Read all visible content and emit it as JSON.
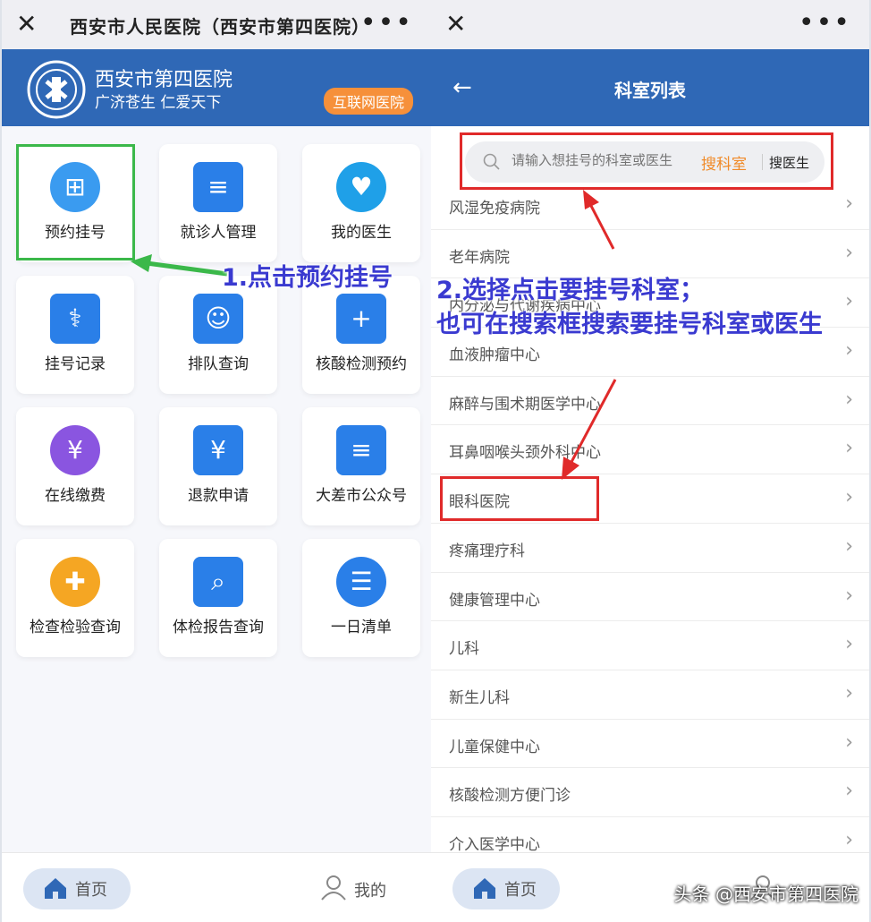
{
  "left_screen": {
    "window_title": "西安市人民医院（西安市第四医院）",
    "header": {
      "hospital_name": "西安市第四医院",
      "slogan": "广济苍生 仁爱天下",
      "badge": "互联网医院"
    },
    "services": [
      {
        "label": "预约挂号",
        "icon": "register-icon",
        "color": "#3a9bf0"
      },
      {
        "label": "就诊人管理",
        "icon": "patient-card-icon",
        "color": "#2a7fe8"
      },
      {
        "label": "我的医生",
        "icon": "heart-icon",
        "color": "#1fa0e8"
      },
      {
        "label": "挂号记录",
        "icon": "stethoscope-icon",
        "color": "#2a7fe8"
      },
      {
        "label": "排队查询",
        "icon": "queue-people-icon",
        "color": "#2a7fe8"
      },
      {
        "label": "核酸检测预约",
        "icon": "test-clock-icon",
        "color": "#2a7fe8"
      },
      {
        "label": "在线缴费",
        "icon": "payment-icon",
        "color": "#8a55e0"
      },
      {
        "label": "退款申请",
        "icon": "refund-icon",
        "color": "#2a7fe8"
      },
      {
        "label": "大差市公众号",
        "icon": "public-account-icon",
        "color": "#2a7fe8"
      },
      {
        "label": "检查检验查询",
        "icon": "exam-icon",
        "color": "#f5a623"
      },
      {
        "label": "体检报告查询",
        "icon": "report-search-icon",
        "color": "#2a7fe8"
      },
      {
        "label": "一日清单",
        "icon": "daily-list-icon",
        "color": "#2a7fe8"
      }
    ],
    "annotation": "1.点击预约挂号",
    "tabs": {
      "home": "首页",
      "mine": "我的"
    }
  },
  "right_screen": {
    "nav_title": "科室列表",
    "search": {
      "placeholder": "请输入想挂号的科室或医生",
      "dept_button": "搜科室",
      "doctor_button": "搜医生"
    },
    "departments": [
      "风湿免疫病院",
      "老年病院",
      "内分泌与代谢疾病中心",
      "血液肿瘤中心",
      "麻醉与围术期医学中心",
      "耳鼻咽喉头颈外科中心",
      "眼科医院",
      "疼痛理疗科",
      "健康管理中心",
      "儿科",
      "新生儿科",
      "儿童保健中心",
      "核酸检测方便门诊",
      "介入医学中心"
    ],
    "annotation_line1": "2.选择点击要挂号科室；",
    "annotation_line2": "也可在搜索框搜索要挂号科室或医生",
    "tabs": {
      "home": "首页"
    }
  },
  "watermark": "头条 @西安市第四医院",
  "colors": {
    "brand_blue": "#2f68b6",
    "badge_orange": "#f6903a",
    "highlight_green": "#3bb84a",
    "highlight_red": "#e02a2a",
    "annotation_blue": "#3a3ad0"
  }
}
